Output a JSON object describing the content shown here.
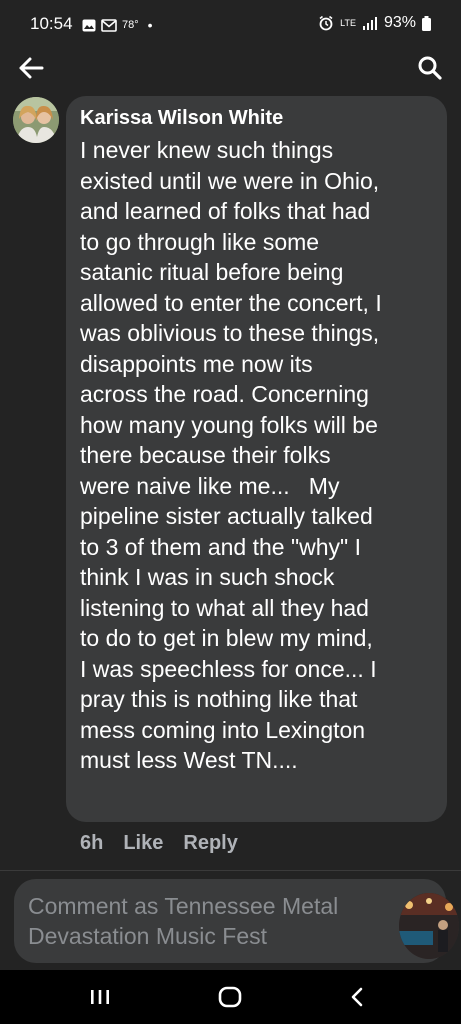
{
  "status_bar": {
    "time": "10:54",
    "temperature": "78°",
    "network": "LTE",
    "battery": "93%"
  },
  "comment": {
    "author": "Karissa Wilson White",
    "text": "I never knew such things\nexisted until we were in Ohio,\nand learned of folks that had\nto go through like some\nsatanic ritual before being\nallowed to enter the concert, I\nwas oblivious to these things,\ndisappoints me now its\nacross the road. Concerning\nhow many young folks will be\nthere because their folks\nwere naive like me...   My\npipeline sister actually talked\nto 3 of them and the \"why\" I\nthink I was in such shock\nlistening to what all they had\nto do to get in blew my mind,\nI was speechless for once... I\npray this is nothing like that\nmess coming into Lexington\nmust less West TN....",
    "time_ago": "6h",
    "like_label": "Like",
    "reply_label": "Reply"
  },
  "composer": {
    "placeholder": "Comment as Tennessee Metal Devastation Music Fest"
  }
}
